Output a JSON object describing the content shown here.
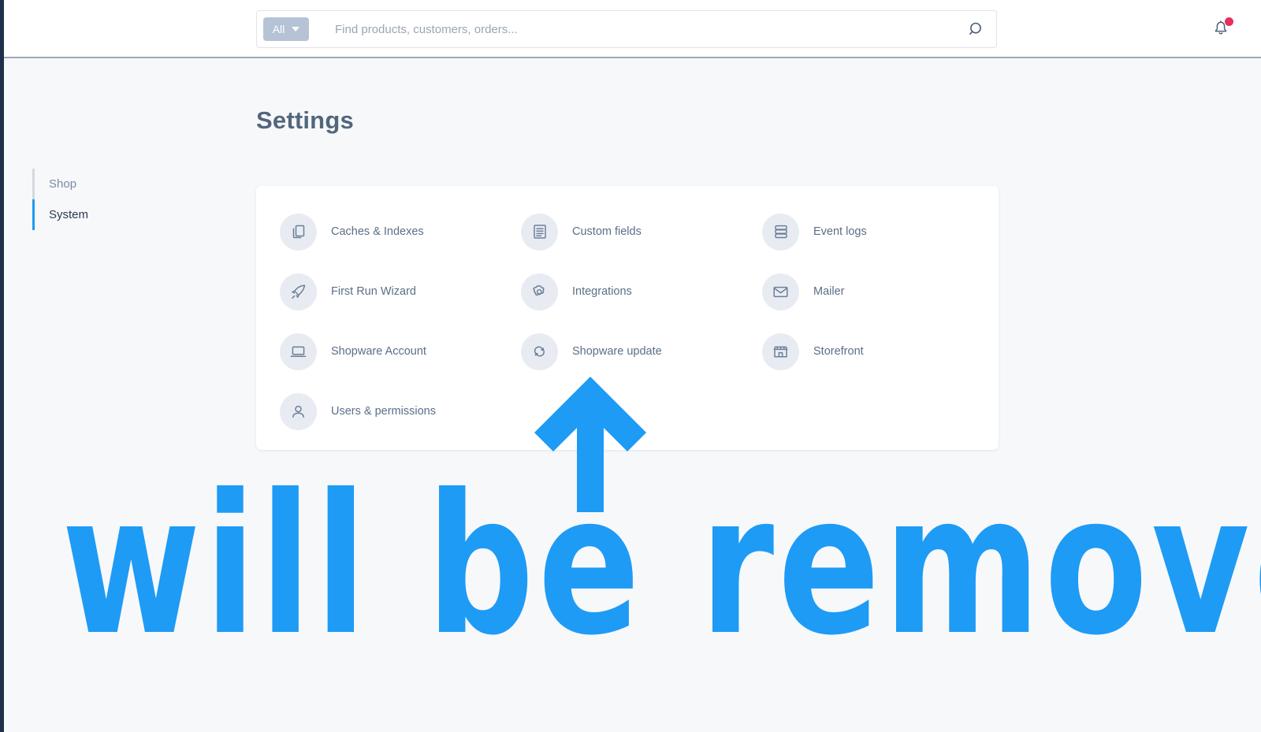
{
  "header": {
    "search": {
      "scope_label": "All",
      "scope_icon": "chevron-down-icon",
      "placeholder": "Find products, customers, orders...",
      "value": "",
      "search_icon": "search-icon"
    },
    "notifications": {
      "icon": "bell-icon",
      "has_unread": true,
      "dot_color": "#e5305a"
    }
  },
  "page": {
    "title": "Settings"
  },
  "sidebar": {
    "items": [
      {
        "label": "Shop",
        "active": false
      },
      {
        "label": "System",
        "active": true
      }
    ]
  },
  "settings": {
    "items": [
      {
        "label": "Caches & Indexes",
        "icon": "copy-documents-icon"
      },
      {
        "label": "Custom fields",
        "icon": "document-lines-icon"
      },
      {
        "label": "Event logs",
        "icon": "database-stack-icon"
      },
      {
        "label": "First Run Wizard",
        "icon": "rocket-icon"
      },
      {
        "label": "Integrations",
        "icon": "gear-icon"
      },
      {
        "label": "Mailer",
        "icon": "envelope-icon"
      },
      {
        "label": "Shopware Account",
        "icon": "laptop-icon"
      },
      {
        "label": "Shopware update",
        "icon": "refresh-sync-icon"
      },
      {
        "label": "Storefront",
        "icon": "storefront-icon"
      },
      {
        "label": "Users & permissions",
        "icon": "person-icon"
      }
    ]
  },
  "annotation": {
    "text": "will be removed",
    "arrow_icon": "arrow-up-icon",
    "color": "#1e9bf5"
  },
  "colors": {
    "accent": "#1f9bf0",
    "page_bg": "#f7f8fa",
    "card_bg": "#ffffff",
    "icon_bubble": "#e8ecf2",
    "text_muted": "#798ca5",
    "rail": "#20304b"
  }
}
